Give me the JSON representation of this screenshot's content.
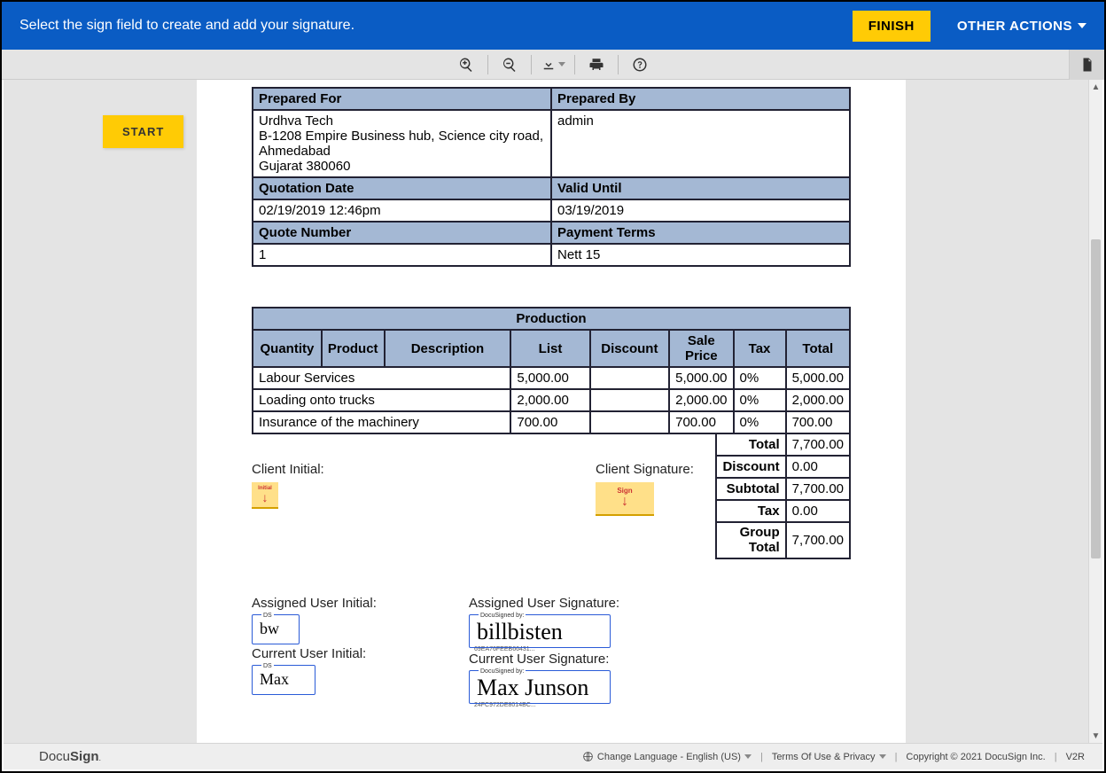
{
  "banner": {
    "message": "Select the sign field to create and add your signature.",
    "finish": "FINISH",
    "other_actions": "OTHER ACTIONS"
  },
  "toolbar": {
    "zoom_in": "zoom-in",
    "zoom_out": "zoom-out",
    "download": "download",
    "print": "print",
    "help": "help",
    "doc_panel": "documents"
  },
  "start_button": "START",
  "doc": {
    "prepared_for_header": "Prepared For",
    "prepared_by_header": "Prepared By",
    "prepared_for_line1": "Urdhva Tech",
    "prepared_for_line2": "B-1208 Empire Business hub, Science city road,",
    "prepared_for_line3": "Ahmedabad",
    "prepared_for_line4": "Gujarat 380060",
    "prepared_by_value": "admin",
    "quotation_date_header": "Quotation Date",
    "valid_until_header": "Valid Until",
    "quotation_date_value": "02/19/2019 12:46pm",
    "valid_until_value": "03/19/2019",
    "quote_number_header": "Quote Number",
    "payment_terms_header": "Payment Terms",
    "quote_number_value": "1",
    "payment_terms_value": "Nett 15"
  },
  "production": {
    "title": "Production",
    "headers": {
      "quantity": "Quantity",
      "product": "Product",
      "description": "Description",
      "list": "List",
      "discount": "Discount",
      "sale_price": "Sale Price",
      "tax": "Tax",
      "total": "Total"
    },
    "rows": [
      {
        "desc": "Labour Services",
        "list": "5,000.00",
        "discount": "",
        "sale": "5,000.00",
        "tax": "0%",
        "total": "5,000.00"
      },
      {
        "desc": "Loading onto trucks",
        "list": "2,000.00",
        "discount": "",
        "sale": "2,000.00",
        "tax": "0%",
        "total": "2,000.00"
      },
      {
        "desc": "Insurance of the machinery",
        "list": "700.00",
        "discount": "",
        "sale": "700.00",
        "tax": "0%",
        "total": "700.00"
      }
    ],
    "totals": {
      "total_label": "Total",
      "total_val": "7,700.00",
      "discount_label": "Discount",
      "discount_val": "0.00",
      "subtotal_label": "Subtotal",
      "subtotal_val": "7,700.00",
      "tax_label": "Tax",
      "tax_val": "0.00",
      "group_label": "Group Total",
      "group_val": "7,700.00"
    }
  },
  "signatures": {
    "client_initial_label": "Client Initial:",
    "client_signature_label": "Client Signature:",
    "initial_tag": "Initial",
    "sign_tag": "Sign",
    "assigned_initial_label": "Assigned User Initial:",
    "assigned_sig_label": "Assigned User Signature:",
    "current_initial_label": "Current User Initial:",
    "current_sig_label": "Current User Signature:",
    "docusigned_by": "DocuSigned by:",
    "ds_label": "DS",
    "assigned_sig_scribble": "billbisten",
    "assigned_sig_id": "69EA76FEEB66431...",
    "assigned_init_scribble": "bw",
    "current_sig_scribble": "Max Junson",
    "current_sig_id": "24FC972DE8014BC...",
    "current_init_scribble": "Max"
  },
  "footer": {
    "logo_a": "Docu",
    "logo_b": "Sign",
    "language_label": "Change Language - English (US)",
    "terms": "Terms Of Use & Privacy",
    "copyright": "Copyright © 2021 DocuSign Inc.",
    "version": "V2R"
  }
}
